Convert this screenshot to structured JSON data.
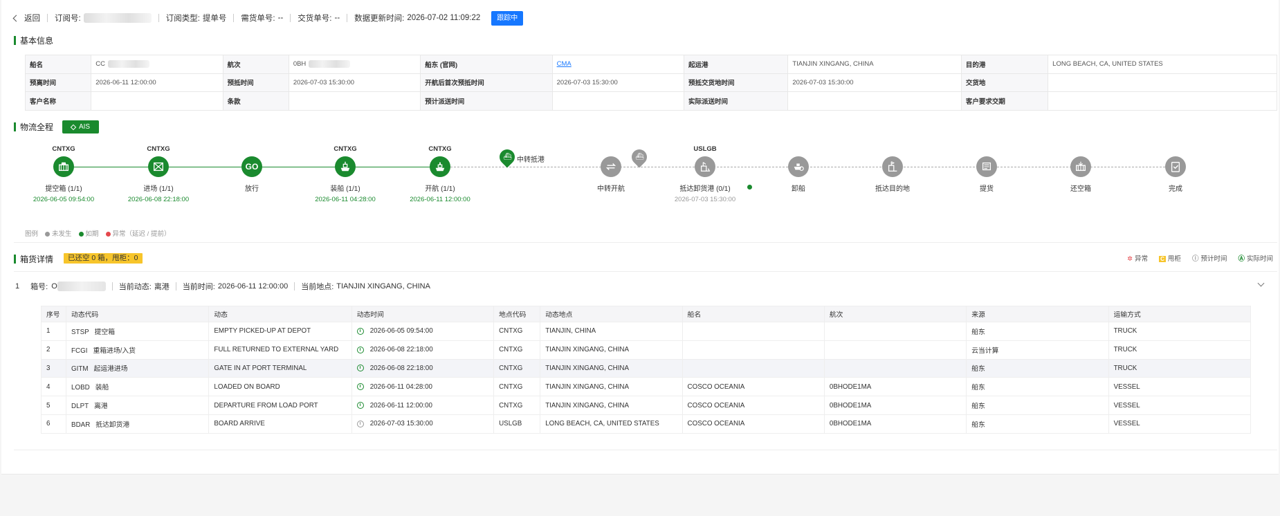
{
  "header": {
    "back_label": "返回",
    "order_label": "订阅号:",
    "type_label": "订阅类型:",
    "type_value": "提单号",
    "booking_label": "需货单号:",
    "booking_value": "--",
    "delivery_label": "交货单号:",
    "delivery_value": "--",
    "updated_label": "数据更新时间:",
    "updated_value": "2026-07-02 11:09:22",
    "track_button": "跟踪中"
  },
  "basic": {
    "title": "基本信息",
    "rows": [
      [
        "船名",
        "CC",
        "航次",
        "0BH",
        "船东 (官网)",
        "CMA",
        "起运港",
        "TIANJIN XINGANG, CHINA",
        "目的港",
        "LONG BEACH, CA, UNITED STATES"
      ],
      [
        "预离时间",
        "2026-06-11 12:00:00",
        "预抵时间",
        "2026-07-03 15:30:00",
        "开航后首次预抵时间",
        "2026-07-03 15:30:00",
        "预抵交货地时间",
        "2026-07-03 15:30:00",
        "交货地",
        ""
      ],
      [
        "客户名称",
        "",
        "条款",
        "",
        "预计派送时间",
        "",
        "实际派送时间",
        "",
        "客户要求交期",
        ""
      ]
    ]
  },
  "logistics": {
    "title": "物流全程",
    "ais_label": "AIS",
    "nodes": [
      {
        "code": "CNTXG",
        "label": "提空箱 (1/1)",
        "time": "2026-06-05 09:54:00",
        "icon": "container-icon"
      },
      {
        "code": "CNTXG",
        "label": "进场 (1/1)",
        "time": "2026-06-08 22:18:00",
        "icon": "gate-in-icon"
      },
      {
        "code": "",
        "label": "放行",
        "time": "",
        "icon": "go-icon",
        "text": "GO"
      },
      {
        "code": "CNTXG",
        "label": "装船 (1/1)",
        "time": "2026-06-11 04:28:00",
        "icon": "ship-load-icon"
      },
      {
        "code": "CNTXG",
        "label": "开航 (1/1)",
        "time": "2026-06-11 12:00:00",
        "icon": "ship-depart-icon"
      },
      {
        "code": "",
        "label": "中转抵港",
        "time": "",
        "icon": "transship-arrive-icon"
      },
      {
        "code": "",
        "label": "中转开航",
        "time": "",
        "icon": "transship-depart-icon"
      },
      {
        "code": "USLGB",
        "label": "抵达卸货港 (0/1)",
        "time": "2026-07-03 15:30:00",
        "icon": "port-arrive-icon"
      },
      {
        "code": "",
        "label": "卸船",
        "time": "",
        "icon": "discharge-icon"
      },
      {
        "code": "",
        "label": "抵达目的地",
        "time": "",
        "icon": "destination-icon"
      },
      {
        "code": "",
        "label": "提货",
        "time": "",
        "icon": "pickup-icon"
      },
      {
        "code": "",
        "label": "还空箱",
        "time": "",
        "icon": "return-empty-icon"
      },
      {
        "code": "",
        "label": "完成",
        "time": "",
        "icon": "complete-icon"
      }
    ],
    "legend": {
      "title": "图例",
      "not_happened": "未发生",
      "on_time": "如期",
      "abnormal": "异常（延迟 / 提前）"
    }
  },
  "cargo": {
    "title": "箱货详情",
    "badge": "已还空 0 箱，甩柜：0",
    "legend": {
      "abnormal": "异常",
      "dropped": "甩柜",
      "expected": "预计时间",
      "actual": "实际时间"
    },
    "container": {
      "index": "1",
      "no_label": "箱号:",
      "no_value": "O",
      "status_label": "当前动态:",
      "status_value": "离港",
      "time_label": "当前时间:",
      "time_value": "2026-06-11 12:00:00",
      "place_label": "当前地点:",
      "place_value": "TIANJIN XINGANG, CHINA"
    },
    "columns": [
      "序号",
      "动态代码",
      "动态",
      "动态时间",
      "地点代码",
      "动态地点",
      "船名",
      "航次",
      "来源",
      "运输方式"
    ],
    "rows": [
      {
        "no": "1",
        "code": "STSP",
        "code_cn": "提空箱",
        "event": "EMPTY PICKED-UP AT DEPOT",
        "actual": true,
        "time": "2026-06-05 09:54:00",
        "loc_code": "CNTXG",
        "loc": "TIANJIN, CHINA",
        "vessel": "",
        "voyage": "",
        "source": "船东",
        "mode": "TRUCK"
      },
      {
        "no": "2",
        "code": "FCGI",
        "code_cn": "重箱进场/入货",
        "event": "FULL RETURNED TO EXTERNAL YARD",
        "actual": true,
        "time": "2026-06-08 22:18:00",
        "loc_code": "CNTXG",
        "loc": "TIANJIN XINGANG, CHINA",
        "vessel": "",
        "voyage": "",
        "source": "云当计算",
        "mode": "TRUCK"
      },
      {
        "no": "3",
        "code": "GITM",
        "code_cn": "起运港进场",
        "event": "GATE IN AT PORT TERMINAL",
        "actual": true,
        "time": "2026-06-08 22:18:00",
        "loc_code": "CNTXG",
        "loc": "TIANJIN XINGANG, CHINA",
        "vessel": "",
        "voyage": "",
        "source": "船东",
        "mode": "TRUCK"
      },
      {
        "no": "4",
        "code": "LOBD",
        "code_cn": "装船",
        "event": "LOADED ON BOARD",
        "actual": true,
        "time": "2026-06-11 04:28:00",
        "loc_code": "CNTXG",
        "loc": "TIANJIN XINGANG, CHINA",
        "vessel": "COSCO OCEANIA",
        "voyage": "0BHODE1MA",
        "source": "船东",
        "mode": "VESSEL"
      },
      {
        "no": "5",
        "code": "DLPT",
        "code_cn": "离港",
        "event": "DEPARTURE FROM LOAD PORT",
        "actual": true,
        "time": "2026-06-11 12:00:00",
        "loc_code": "CNTXG",
        "loc": "TIANJIN XINGANG, CHINA",
        "vessel": "COSCO OCEANIA",
        "voyage": "0BHODE1MA",
        "source": "船东",
        "mode": "VESSEL"
      },
      {
        "no": "6",
        "code": "BDAR",
        "code_cn": "抵达卸货港",
        "event": "BOARD ARRIVE",
        "actual": false,
        "time": "2026-07-03 15:30:00",
        "loc_code": "USLGB",
        "loc": "LONG BEACH, CA, UNITED STATES",
        "vessel": "COSCO OCEANIA",
        "voyage": "0BHODE1MA",
        "source": "船东",
        "mode": "VESSEL"
      }
    ]
  },
  "colors": {
    "accent": "#1a8a2e",
    "primary": "#1677ff",
    "pending": "#999999",
    "badge": "#f7c52b",
    "abnormal": "#e5484d"
  }
}
